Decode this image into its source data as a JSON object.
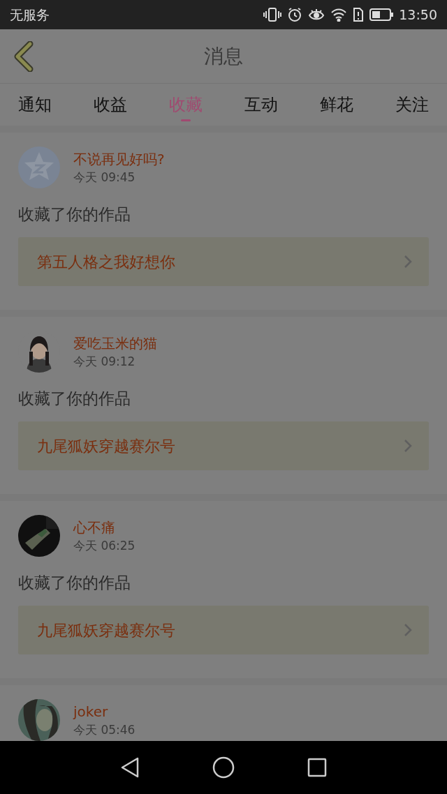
{
  "status_bar": {
    "carrier": "无服务",
    "time": "13:50"
  },
  "header": {
    "title": "消息"
  },
  "tabs": [
    {
      "label": "通知",
      "selected": false
    },
    {
      "label": "收益",
      "selected": false
    },
    {
      "label": "收藏",
      "selected": true
    },
    {
      "label": "互动",
      "selected": false
    },
    {
      "label": "鲜花",
      "selected": false
    },
    {
      "label": "关注",
      "selected": false
    }
  ],
  "messages": [
    {
      "avatar": {
        "kind": "default"
      },
      "name": "不说再见好吗?",
      "time": "今天 09:45",
      "action": "收藏了你的作品",
      "work_title": "第五人格之我好想你"
    },
    {
      "name": "爱吃玉米的猫",
      "time": "今天 09:12",
      "action": "收藏了你的作品",
      "work_title": "九尾狐妖穿越赛尔号"
    },
    {
      "name": "心不痛",
      "time": "今天 06:25",
      "action": "收藏了你的作品",
      "work_title": "九尾狐妖穿越赛尔号"
    },
    {
      "name": "joker",
      "time": "今天 05:46"
    }
  ]
}
